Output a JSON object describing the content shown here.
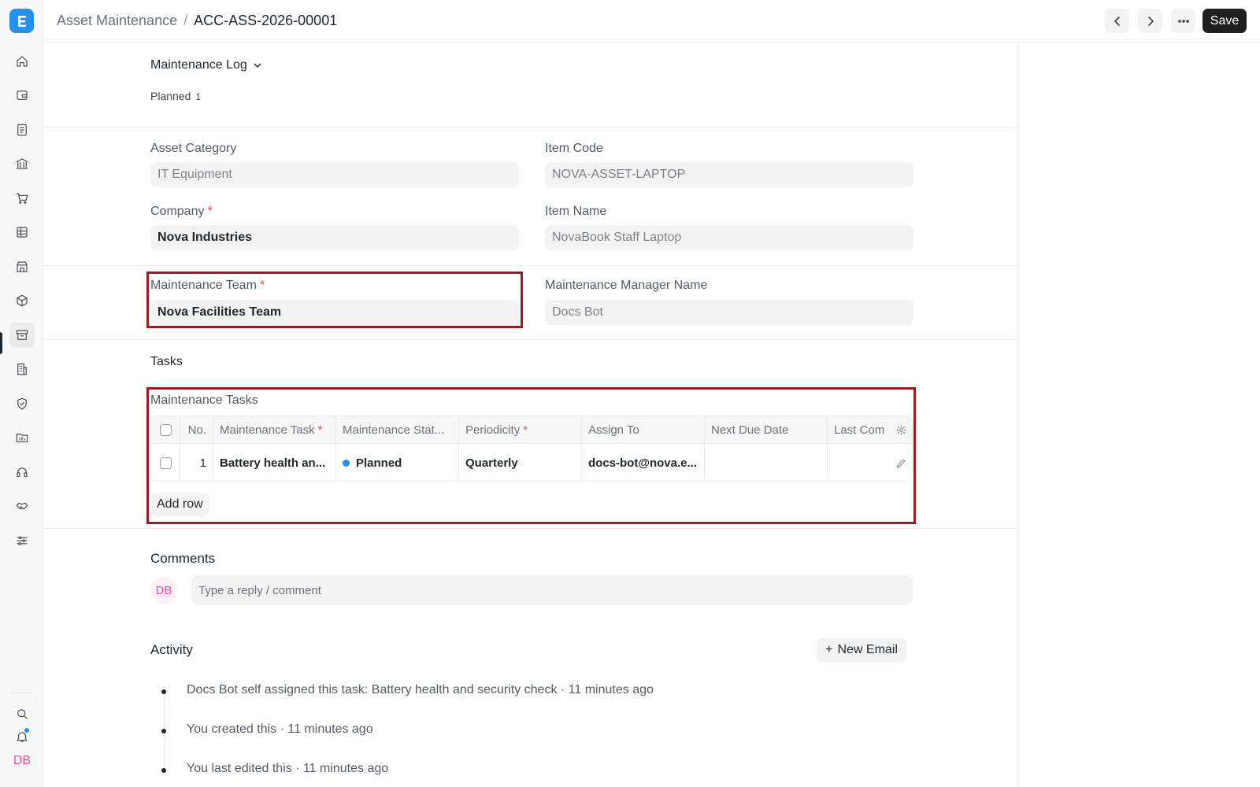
{
  "header": {
    "breadcrumb_parent": "Asset Maintenance",
    "breadcrumb_sep": "/",
    "doc_name": "ACC-ASS-2026-00001",
    "save_label": "Save"
  },
  "sidebar": {
    "logo_letter": "E",
    "user_initials": "DB",
    "items": [
      "home-icon",
      "wallet-icon",
      "file-text-icon",
      "bank-icon",
      "cart-icon",
      "grid-table-icon",
      "store-icon",
      "package-icon",
      "archive-icon",
      "building-icon",
      "shield-icon",
      "folder-chart-icon",
      "headset-icon",
      "handshake-icon",
      "sliders-icon"
    ],
    "active_item": "archive-icon"
  },
  "maintenance_log": {
    "title": "Maintenance Log",
    "status": "Planned",
    "count": "1"
  },
  "fields": {
    "asset_category": {
      "label": "Asset Category",
      "value": "IT Equipment"
    },
    "item_code": {
      "label": "Item Code",
      "value": "NOVA-ASSET-LAPTOP"
    },
    "company": {
      "label": "Company",
      "value": "Nova Industries"
    },
    "item_name": {
      "label": "Item Name",
      "value": "NovaBook Staff Laptop"
    },
    "maintenance_team": {
      "label": "Maintenance Team",
      "value": "Nova Facilities Team"
    },
    "maintenance_manager_name": {
      "label": "Maintenance Manager Name",
      "value": "Docs Bot"
    },
    "required_mark": "*"
  },
  "tasks": {
    "section_title": "Tasks",
    "table_label": "Maintenance Tasks",
    "columns": [
      "No.",
      "Maintenance Task",
      "Maintenance Stat...",
      "Periodicity",
      "Assign To",
      "Next Due Date",
      "Last Com"
    ],
    "rows": [
      {
        "no": "1",
        "task": "Battery health an...",
        "status": "Planned",
        "periodicity": "Quarterly",
        "assign_to": "docs-bot@nova.e...",
        "next_due": "",
        "last_completion": ""
      }
    ],
    "add_row_label": "Add row"
  },
  "comments": {
    "title": "Comments",
    "avatar": "DB",
    "placeholder": "Type a reply / comment"
  },
  "activity": {
    "title": "Activity",
    "new_email_label": "New Email",
    "items": [
      "Docs Bot self assigned this task: Battery health and security check · 11 minutes ago",
      "You created this · 11 minutes ago",
      "You last edited this · 11 minutes ago"
    ]
  },
  "colors": {
    "accent": "#2490ef",
    "highlight": "#9b1c20",
    "required": "#e24c4c",
    "avatar": "#e04ea2"
  }
}
